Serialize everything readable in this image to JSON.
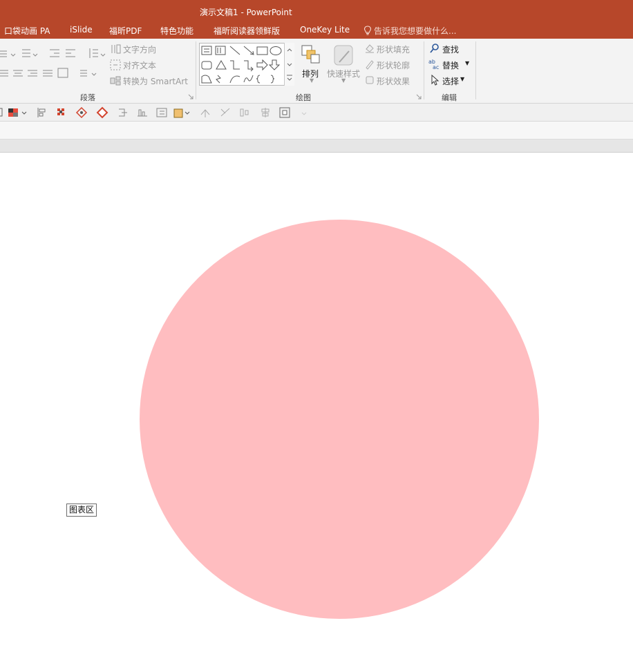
{
  "window": {
    "title": "演示文稿1 - PowerPoint"
  },
  "ribbon_tabs": [
    {
      "label": "口袋动画 PA"
    },
    {
      "label": "iSlide"
    },
    {
      "label": "福昕PDF"
    },
    {
      "label": "特色功能"
    },
    {
      "label": "福昕阅读器领鲜版"
    },
    {
      "label": "OneKey Lite"
    }
  ],
  "tell_me": {
    "placeholder": "告诉我您想要做什么..."
  },
  "paragraph_group": {
    "label": "段落",
    "text_direction": "文字方向",
    "align_text": "对齐文本",
    "convert_smartart": "转换为 SmartArt"
  },
  "drawing_group": {
    "label": "绘图",
    "arrange": "排列",
    "quick_styles": "快速样式",
    "shape_fill": "形状填充",
    "shape_outline": "形状轮廓",
    "shape_effects": "形状效果"
  },
  "editing_group": {
    "label": "编辑",
    "find": "查找",
    "replace": "替换",
    "select": "选择"
  },
  "slide": {
    "chart_area_tooltip": "图表区"
  },
  "colors": {
    "title_bar": "#b7472a",
    "pie_fill": "#ffbdc0"
  },
  "chart_data": {
    "type": "pie",
    "categories": [
      ""
    ],
    "values": [
      100
    ],
    "title": "",
    "colors": [
      "#ffbdc0"
    ]
  }
}
